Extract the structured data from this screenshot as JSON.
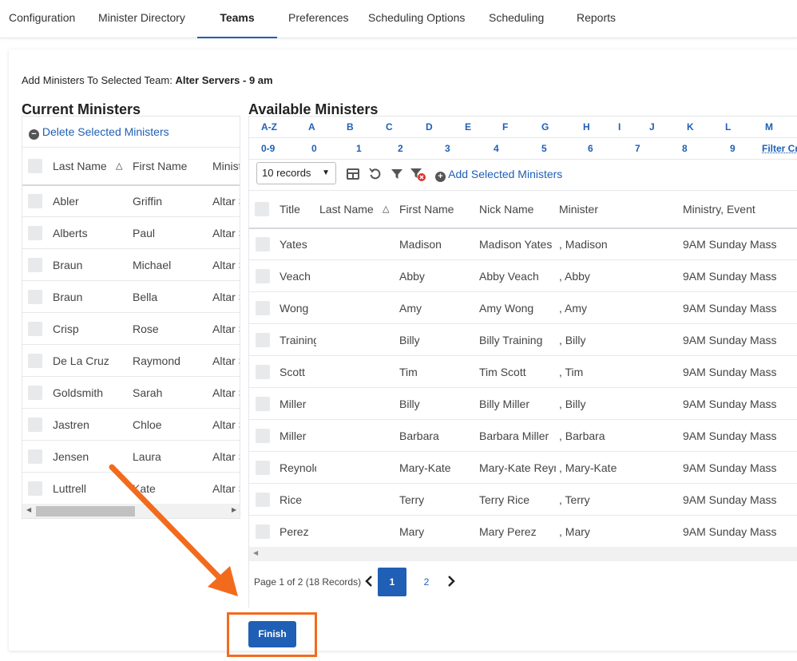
{
  "nav": {
    "tabs": [
      {
        "label": "Configuration"
      },
      {
        "label": "Minister Directory"
      },
      {
        "label": "Teams"
      },
      {
        "label": "Preferences"
      },
      {
        "label": "Scheduling Options"
      },
      {
        "label": "Scheduling"
      },
      {
        "label": "Reports"
      }
    ],
    "active_tab": "Teams"
  },
  "header": {
    "prefix": "Add Ministers To Selected Team:",
    "team_name": "Alter Servers - 9 am"
  },
  "current": {
    "title": "Current Ministers",
    "delete_label": "Delete Selected Ministers",
    "columns": [
      "Last Name",
      "First Name",
      "Minister"
    ],
    "rows": [
      {
        "last": "Abler",
        "first": "Griffin",
        "minister": "Altar Server"
      },
      {
        "last": "Alberts",
        "first": "Paul",
        "minister": "Altar Server"
      },
      {
        "last": "Braun",
        "first": "Michael",
        "minister": "Altar Server"
      },
      {
        "last": "Braun",
        "first": "Bella",
        "minister": "Altar Server"
      },
      {
        "last": "Crisp",
        "first": "Rose",
        "minister": "Altar Server"
      },
      {
        "last": "De La Cruz",
        "first": "Raymond",
        "minister": "Altar Server"
      },
      {
        "last": "Goldsmith",
        "first": "Sarah",
        "minister": "Altar Server"
      },
      {
        "last": "Jastren",
        "first": "Chloe",
        "minister": "Altar Server"
      },
      {
        "last": "Jensen",
        "first": "Laura",
        "minister": "Altar Server"
      },
      {
        "last": "Luttrell",
        "first": "Kate",
        "minister": "Altar Server"
      }
    ]
  },
  "available": {
    "title": "Available Ministers",
    "letters_row1": [
      "A-Z",
      "A",
      "B",
      "C",
      "D",
      "E",
      "F",
      "G",
      "H",
      "I",
      "J",
      "K",
      "L",
      "M"
    ],
    "letters_row2": [
      "0-9",
      "0",
      "1",
      "2",
      "3",
      "4",
      "5",
      "6",
      "7",
      "8",
      "9",
      "Filter Criteria"
    ],
    "records_select": "10 records",
    "add_label": "Add Selected Ministers",
    "columns": [
      "Title",
      "Last Name",
      "First Name",
      "Nick Name",
      "Minister",
      "Ministry, Event"
    ],
    "rows": [
      {
        "last": "Yates",
        "first": "Madison",
        "nick": "Madison Yates",
        "minister": ", Madison",
        "event": "9AM Sunday Mass"
      },
      {
        "last": "Veach",
        "first": "Abby",
        "nick": "Abby Veach",
        "minister": ", Abby",
        "event": "9AM Sunday Mass"
      },
      {
        "last": "Wong",
        "first": "Amy",
        "nick": "Amy Wong",
        "minister": ", Amy",
        "event": "9AM Sunday Mass"
      },
      {
        "last": "Training",
        "first": "Billy",
        "nick": "Billy Training",
        "minister": ", Billy",
        "event": "9AM Sunday Mass"
      },
      {
        "last": "Scott",
        "first": "Tim",
        "nick": "Tim Scott",
        "minister": ", Tim",
        "event": "9AM Sunday Mass"
      },
      {
        "last": "Miller",
        "first": "Billy",
        "nick": "Billy Miller",
        "minister": ", Billy",
        "event": "9AM Sunday Mass"
      },
      {
        "last": "Miller",
        "first": "Barbara",
        "nick": "Barbara Miller",
        "minister": ", Barbara",
        "event": "9AM Sunday Mass"
      },
      {
        "last": "Reynolds",
        "first": "Mary-Kate",
        "nick": "Mary-Kate Reynolds",
        "minister": ", Mary-Kate",
        "event": "9AM Sunday Mass"
      },
      {
        "last": "Rice",
        "first": "Terry",
        "nick": "Terry Rice",
        "minister": ", Terry",
        "event": "9AM Sunday Mass"
      },
      {
        "last": "Perez",
        "first": "Mary",
        "nick": "Mary Perez",
        "minister": ", Mary",
        "event": "9AM Sunday Mass"
      }
    ],
    "pagination": {
      "summary": "Page 1 of 2 (18 Records)",
      "pages": [
        "1",
        "2"
      ],
      "current_page": "1"
    }
  },
  "finish_label": "Finish",
  "colors": {
    "accent": "#1f5fb5",
    "annotation": "#f26b1d"
  }
}
